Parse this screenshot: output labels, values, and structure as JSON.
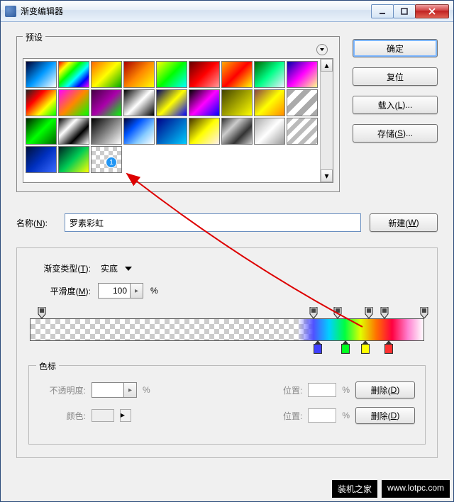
{
  "window": {
    "title": "渐变编辑器"
  },
  "presets": {
    "legend": "预设"
  },
  "buttons": {
    "ok": "确定",
    "reset": "复位",
    "load": "载入(L)...",
    "save": "存储(S)...",
    "new": "新建(W)"
  },
  "name": {
    "label": "名称(N):",
    "value": "罗素彩虹"
  },
  "gradient": {
    "type_label": "渐变类型(T):",
    "type_value": "实底",
    "smoothness_label": "平滑度(M):",
    "smoothness_value": "100",
    "percent": "%"
  },
  "stops": {
    "legend": "色标",
    "opacity_label": "不透明度:",
    "color_label": "颜色:",
    "position_label": "位置:",
    "delete": "删除(D)",
    "percent": "%"
  },
  "annotation": {
    "number": "1"
  },
  "watermark": {
    "text1": "装机之家",
    "text2": "www.lotpc.com"
  },
  "swatches": [
    "linear-gradient(135deg,#003,#09f,#fff)",
    "linear-gradient(135deg,#f00,#ff0,#0f0,#0ff,#00f,#f0f)",
    "linear-gradient(135deg,#f60,#ff0,#0a0)",
    "linear-gradient(135deg,#a00,#f80,#ff0)",
    "linear-gradient(135deg,#ff0,#0f0,#0ff)",
    "linear-gradient(135deg,#600,#f00,#f99)",
    "linear-gradient(135deg,#fa0,#f00,#ff0)",
    "linear-gradient(135deg,#060,#0f8,#eef)",
    "linear-gradient(135deg,#00a,#f0f,#ff8)",
    "linear-gradient(135deg,#222,#f00,#ff0,#0f0)",
    "linear-gradient(135deg,#f0f,#f80,#0f0)",
    "linear-gradient(135deg,#404,#a0a,#0f0)",
    "linear-gradient(135deg,#000,#fff,#000)",
    "linear-gradient(135deg,#006,#ff0,#00f)",
    "linear-gradient(135deg,#000,#f0f,#00f)",
    "linear-gradient(135deg,#440,#ff0)",
    "linear-gradient(135deg,#844,#ff0,#f80)",
    "repeating-linear-gradient(135deg,#aaa 0 8px,#fff 8px 16px)",
    "linear-gradient(135deg,#020,#0f0,#060)",
    "linear-gradient(135deg,#000,#fff,#000,#fff)",
    "linear-gradient(135deg,#000,#fff)",
    "linear-gradient(135deg,#003,#05f,#8cf,#fff)",
    "linear-gradient(135deg,#008,#0cf)",
    "linear-gradient(135deg,#430,#ff0,#fee)",
    "linear-gradient(135deg,#333,#ccc,#333,#ccc)",
    "linear-gradient(135deg,#aaa,#fff,#999)",
    "repeating-linear-gradient(135deg,#bbb 0 6px,#fff 6px 12px)",
    "linear-gradient(135deg,#001038,#0030c0,#3b6bff)",
    "linear-gradient(135deg,#022,#0c5,#ff0)",
    "repeating-conic-gradient(#ccc 0 25%,#fff 0 50%) 0 0/12px 12px"
  ],
  "color_stops": [
    {
      "pos": 73,
      "color": "#4040ff"
    },
    {
      "pos": 80,
      "color": "#00ff20"
    },
    {
      "pos": 85,
      "color": "#ffff00"
    },
    {
      "pos": 91,
      "color": "#ff3030"
    }
  ],
  "opacity_stops": [
    3,
    72,
    78,
    86,
    90,
    100
  ],
  "chart_data": null
}
